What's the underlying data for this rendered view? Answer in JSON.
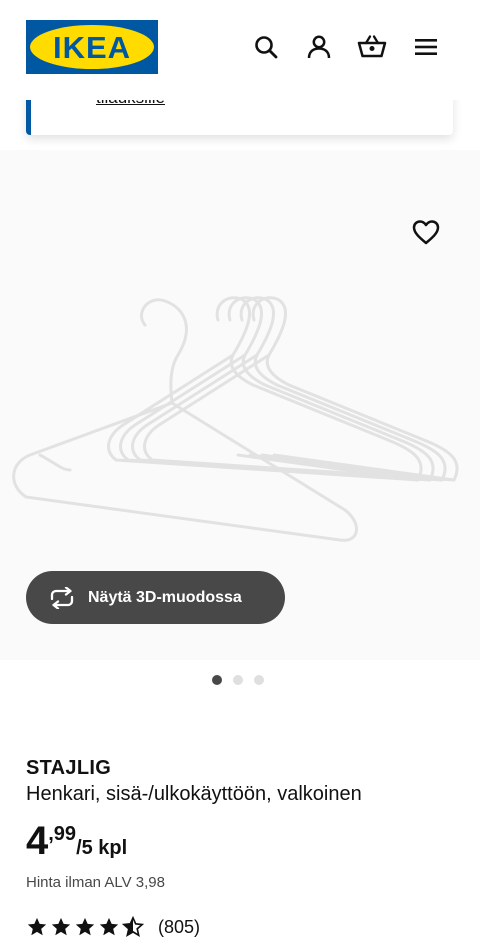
{
  "header": {
    "logo_text": "IKEA",
    "brand_colors": {
      "blue": "#0058a3",
      "yellow": "#ffdb00"
    },
    "icons": [
      "search-icon",
      "account-icon",
      "basket-icon",
      "menu-icon"
    ]
  },
  "banner": {
    "link_text": "tilauksille"
  },
  "gallery": {
    "favorite_icon": "heart-icon",
    "view_3d_label": "Näytä 3D-muodossa",
    "view_3d_icon": "rotate-arrows-icon",
    "image_count": 3,
    "active_image": 1,
    "image_background": "#fafafa"
  },
  "product": {
    "name": "STAJLIG",
    "description": "Henkari, sisä-/ulkokäyttöön, valkoinen",
    "price_integer": "4",
    "price_decimal": ",99",
    "price_unit": "/5 kpl",
    "price_ex_vat": "Hinta ilman ALV 3,98",
    "rating": 4.5,
    "rating_max": 5,
    "review_count": "(805)"
  }
}
